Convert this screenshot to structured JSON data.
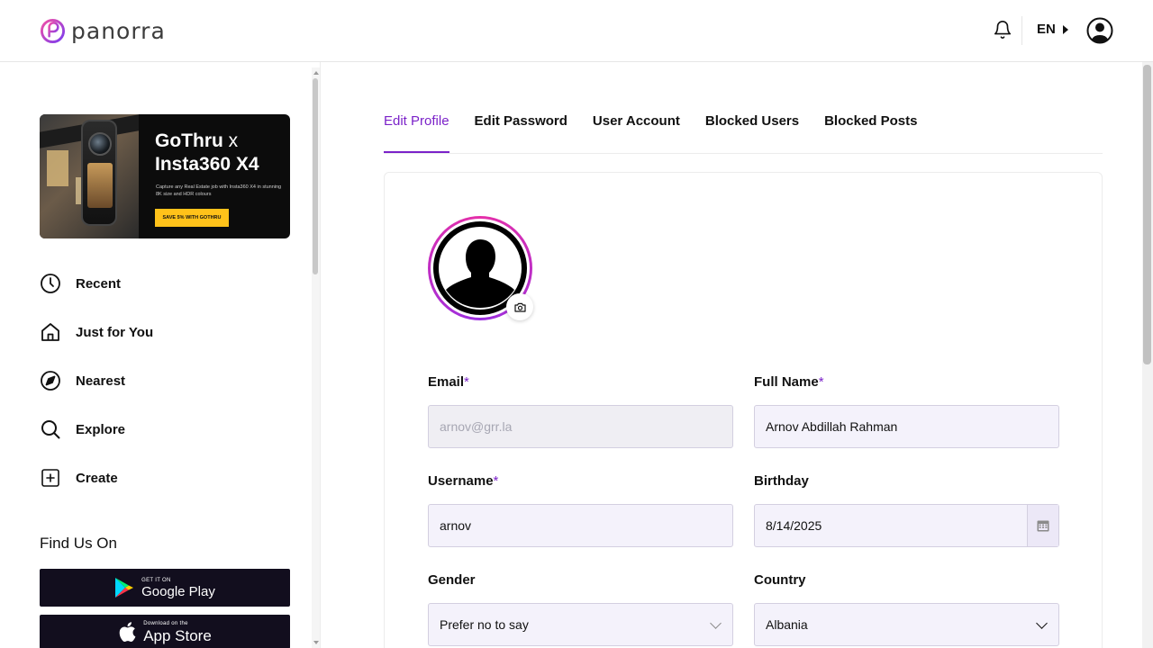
{
  "header": {
    "logo_text": "panorra",
    "language": "EN",
    "icons": {
      "notifications": "bell-icon",
      "profile": "user-circle-icon"
    }
  },
  "sidebar": {
    "banner": {
      "title_part1": "GoThru",
      "title_x": "x",
      "title_line2": "Insta360 X4",
      "subtitle": "Capture any Real Estate job with Insta360 X4 in stunning 8K size and HDR colours",
      "cta": "SAVE 5% WITH GOTHRU"
    },
    "items": [
      {
        "label": "Recent",
        "icon": "clock-icon"
      },
      {
        "label": "Just for You",
        "icon": "home-icon"
      },
      {
        "label": "Nearest",
        "icon": "navigation-icon"
      },
      {
        "label": "Explore",
        "icon": "search-icon"
      },
      {
        "label": "Create",
        "icon": "plus-square-icon"
      }
    ],
    "find_us": "Find Us On",
    "stores": {
      "google_small": "GET IT ON",
      "google_big": "Google Play",
      "apple_small": "Download on the",
      "apple_big": "App Store"
    }
  },
  "tabs": [
    "Edit Profile",
    "Edit Password",
    "User Account",
    "Blocked Users",
    "Blocked Posts"
  ],
  "active_tab": "Edit Profile",
  "form": {
    "required_mark": "*",
    "email": {
      "label": "Email",
      "value": "arnov@grr.la",
      "required": true,
      "disabled": true
    },
    "full_name": {
      "label": "Full Name",
      "value": "Arnov Abdillah Rahman",
      "required": true
    },
    "username": {
      "label": "Username",
      "value": "arnov",
      "required": true
    },
    "birthday": {
      "label": "Birthday",
      "value": "8/14/2025"
    },
    "gender": {
      "label": "Gender",
      "value": "Prefer no to say"
    },
    "country": {
      "label": "Country",
      "value": "Albania"
    }
  },
  "colors": {
    "accent": "#7b22c9",
    "ring_pink": "#e62fa8",
    "input_bg": "#f4f2fb",
    "store_bg": "#120e1e"
  }
}
